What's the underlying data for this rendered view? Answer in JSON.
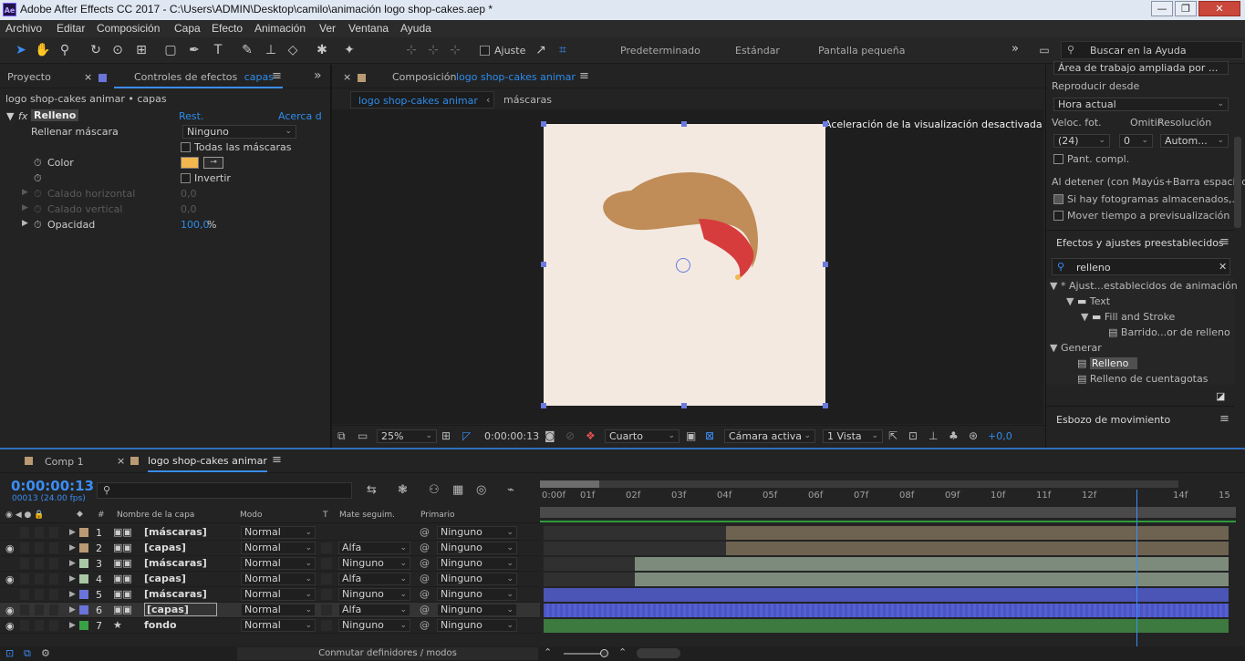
{
  "window": {
    "title": "Adobe After Effects CC 2017 - C:\\Users\\ADMIN\\Desktop\\camilo\\animación logo shop-cakes.aep *",
    "app_icon": "Ae"
  },
  "menu": [
    "Archivo",
    "Editar",
    "Composición",
    "Capa",
    "Efecto",
    "Animación",
    "Ver",
    "Ventana",
    "Ayuda"
  ],
  "toolbar": {
    "snap_label": "Ajuste",
    "workspaces": [
      "Predeterminado",
      "Estándar",
      "Pantalla pequeña"
    ],
    "help_search_placeholder": "Buscar en la Ayuda"
  },
  "left_panel": {
    "tab_project": "Proyecto",
    "tab_effects_controls": "Controles de efectos",
    "tab_effects_layer": "capas",
    "breadcrumb": "logo shop-cakes animar • capas",
    "effect_name": "Relleno",
    "reset": "Rest.",
    "about": "Acerca d",
    "props": {
      "fill_mask_label": "Rellenar máscara",
      "fill_mask_value": "Ninguno",
      "all_masks_label": "Todas las máscaras",
      "color_label": "Color",
      "color_value": "#f2b84f",
      "invert_label": "Invertir",
      "horiz_feather_label": "Calado horizontal",
      "horiz_feather_value": "0,0",
      "vert_feather_label": "Calado vertical",
      "vert_feather_value": "0,0",
      "opacity_label": "Opacidad",
      "opacity_value": "100,0",
      "opacity_unit": "%"
    }
  },
  "comp_panel": {
    "prefix": "Composición",
    "name": "logo shop-cakes animar",
    "tab_active": "logo shop-cakes animar",
    "tab_other": "máscaras",
    "notice": "Aceleración de la visualización desactivada",
    "canvas_bg": "#f3e9e1",
    "footer": {
      "zoom": "25%",
      "timecode": "0:00:00:13",
      "resolution": "Cuarto",
      "camera": "Cámara activa",
      "views": "1 Vista",
      "exposure": "+0,0"
    }
  },
  "right_panel": {
    "workspace_dd": "Área de trabajo ampliada por ...",
    "play_from_label": "Reproducir desde",
    "play_from_value": "Hora actual",
    "fps_label": "Veloc. fot.",
    "skip_label": "Omitir",
    "res_label": "Resolución",
    "fps_value": "(24)",
    "skip_value": "0",
    "res_value": "Autom...",
    "fullscreen_label": "Pant. compl.",
    "on_stop_label": "Al detener (con Mayús+Barra espaciad",
    "cached_label": "Si hay fotogramas almacenados,...",
    "move_time_label": "Mover tiempo a previsualización",
    "effects_title": "Efectos y ajustes preestablecidos",
    "effects_search": "relleno",
    "tree": [
      "* Ajust...establecidos de animación",
      "Text",
      "Fill and Stroke",
      "Barrido...or de relleno",
      "Generar",
      "Relleno",
      "Relleno de cuentagotas"
    ],
    "motion_sketch": "Esbozo de movimiento"
  },
  "timeline": {
    "tab_comp1": "Comp 1",
    "tab_active": "logo shop-cakes animar",
    "timecode": "0:00:00:13",
    "frame_info": "00013 (24.00 fps)",
    "search_placeholder": "",
    "headers": {
      "num": "#",
      "layer_name": "Nombre de la capa",
      "mode": "Modo",
      "t": "T",
      "track_matte": "Mate seguim.",
      "parent": "Primario"
    },
    "ruler": [
      "0:00f",
      "01f",
      "02f",
      "03f",
      "04f",
      "05f",
      "06f",
      "07f",
      "08f",
      "09f",
      "10f",
      "11f",
      "12f",
      "14f",
      "15"
    ],
    "current_frame": 13,
    "layers": [
      {
        "num": "1",
        "name": "[máscaras]",
        "mode": "Normal",
        "matte": "",
        "parent": "Ninguno",
        "label": "#b99a72",
        "visible": false,
        "start": 4
      },
      {
        "num": "2",
        "name": "[capas]",
        "mode": "Normal",
        "matte": "Alfa",
        "parent": "Ninguno",
        "label": "#b99a72",
        "visible": true,
        "start": 4
      },
      {
        "num": "3",
        "name": "[máscaras]",
        "mode": "Normal",
        "matte": "Ninguno",
        "parent": "Ninguno",
        "label": "#a9c7a5",
        "visible": false,
        "start": 2
      },
      {
        "num": "4",
        "name": "[capas]",
        "mode": "Normal",
        "matte": "Alfa",
        "parent": "Ninguno",
        "label": "#a9c7a5",
        "visible": true,
        "start": 2
      },
      {
        "num": "5",
        "name": "[máscaras]",
        "mode": "Normal",
        "matte": "Ninguno",
        "parent": "Ninguno",
        "label": "#6b74d8",
        "visible": false,
        "start": 0
      },
      {
        "num": "6",
        "name": "[capas]",
        "mode": "Normal",
        "matte": "Alfa",
        "parent": "Ninguno",
        "label": "#6b74d8",
        "visible": true,
        "start": 0
      },
      {
        "num": "7",
        "name": "fondo",
        "mode": "Normal",
        "matte": "Ninguno",
        "parent": "Ninguno",
        "label": "#3aa046",
        "visible": true,
        "start": 0
      }
    ],
    "footer": "Conmutar definidores / modos"
  }
}
